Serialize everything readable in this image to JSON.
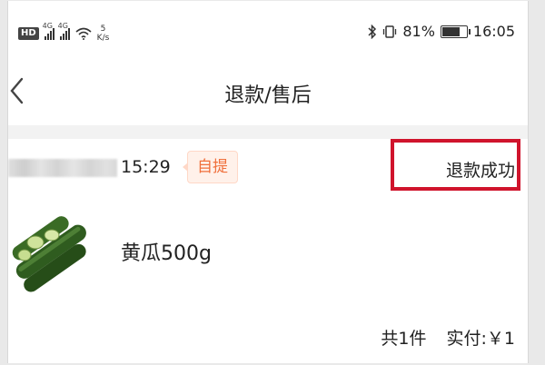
{
  "status_bar": {
    "hd_label": "HD",
    "net1": "4G",
    "net2": "4G",
    "speed_value": "5",
    "speed_unit": "K/s",
    "battery_percent": "81%",
    "battery_level": 0.81,
    "time": "16:05",
    "icons": [
      "hd-icon",
      "signal-icon",
      "signal-icon",
      "wifi-icon",
      "bluetooth-icon",
      "vibrate-icon",
      "battery-icon"
    ]
  },
  "nav": {
    "back_icon": "chevron-left-icon",
    "title": "退款/售后"
  },
  "order": {
    "time": "15:29",
    "tag": "自提",
    "status": "退款成功"
  },
  "product": {
    "name": "黄瓜500g",
    "image": "cucumber-image"
  },
  "summary": {
    "count": "共1件",
    "paid": "实付:￥1"
  },
  "colors": {
    "tag_text": "#f0703c",
    "tag_bg": "#fff1ea",
    "highlight": "#d0142c"
  }
}
